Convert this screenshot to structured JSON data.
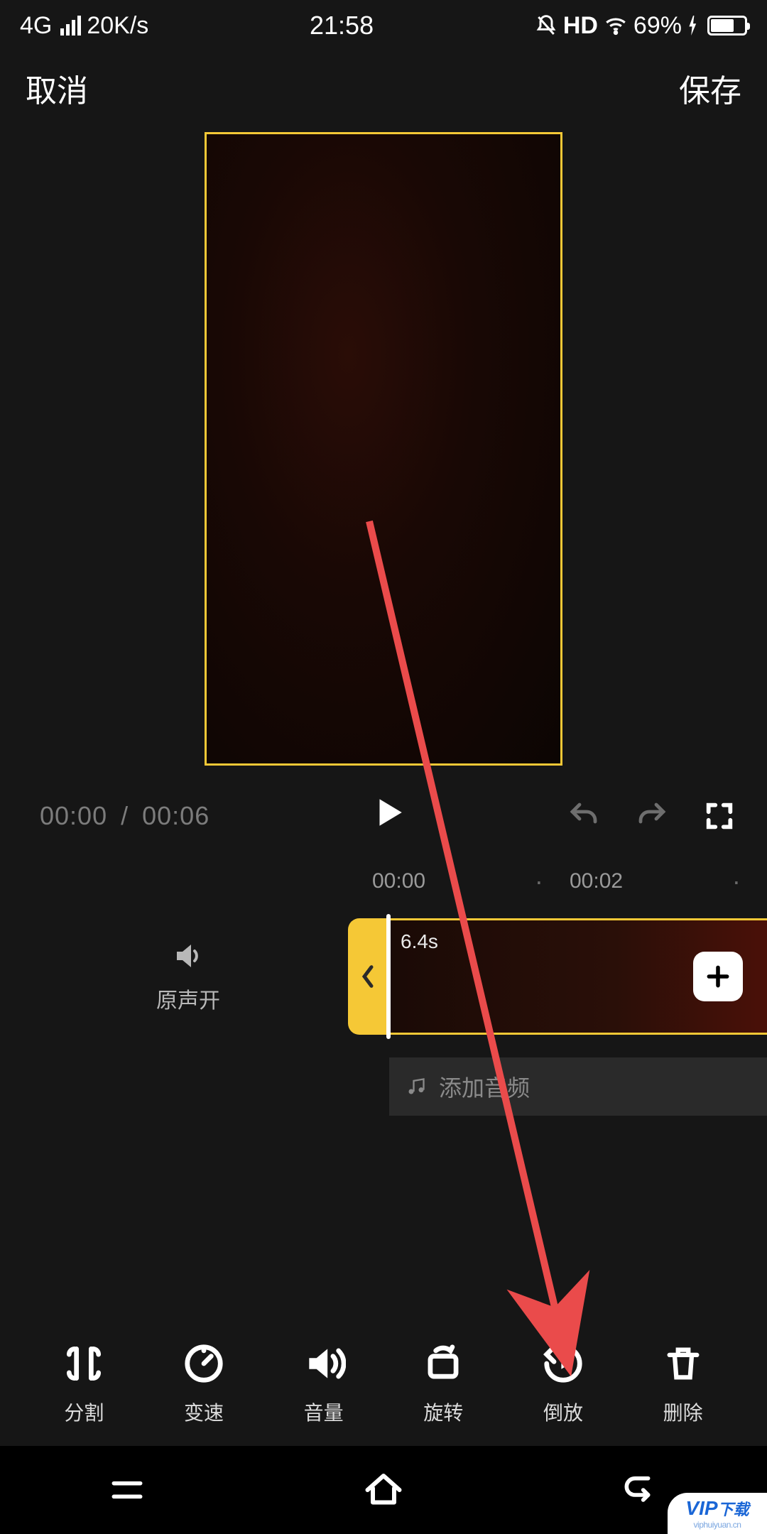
{
  "status": {
    "network": "4G",
    "speed": "20K/s",
    "time": "21:58",
    "hd": "HD",
    "battery_pct": "69%"
  },
  "header": {
    "cancel": "取消",
    "save": "保存"
  },
  "playback": {
    "current": "00:00",
    "sep": "/",
    "total": "00:06"
  },
  "ruler": {
    "t0": "00:00",
    "t1": "00:02"
  },
  "sound": {
    "label": "原声开"
  },
  "clip": {
    "duration": "6.4s"
  },
  "audio": {
    "add_label": "添加音频"
  },
  "tools": {
    "split": "分割",
    "speed": "变速",
    "volume": "音量",
    "rotate": "旋转",
    "reverse": "倒放",
    "delete": "删除"
  },
  "watermark": {
    "brand": "VIP",
    "sub": "下载",
    "site": "viphuiyuan.cn"
  }
}
